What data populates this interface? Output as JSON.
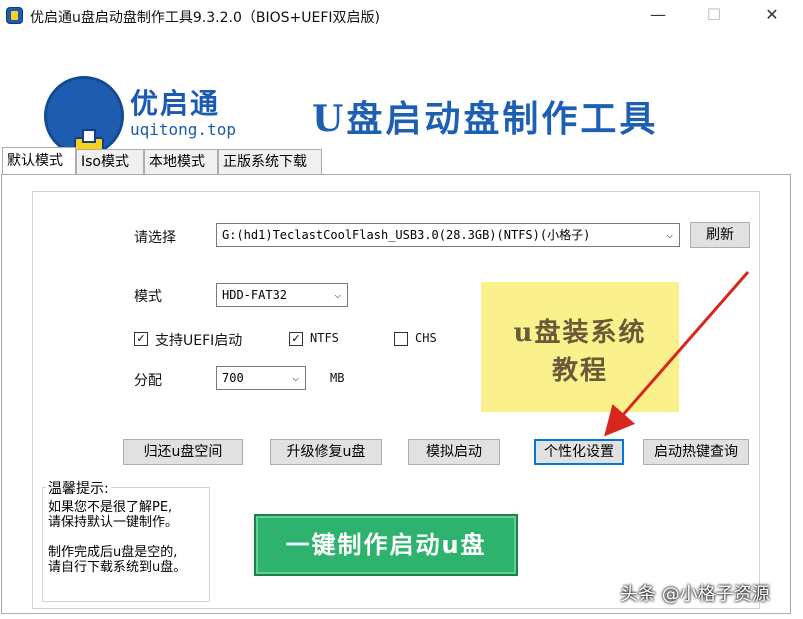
{
  "window": {
    "title": "优启通u盘启动盘制作工具9.3.2.0（BIOS+UEFI双启版)",
    "minimize": "—",
    "maximize": "☐",
    "close": "✕"
  },
  "banner": {
    "logo_name": "优启通",
    "logo_domain": "uqitong.top",
    "heading": "U盘启动盘制作工具"
  },
  "tabs": [
    "默认模式",
    "Iso模式",
    "本地模式",
    "正版系统下载"
  ],
  "form": {
    "select_label": "请选择",
    "device_value": "G:(hd1)TeclastCoolFlash_USB3.0(28.3GB)(NTFS)(小格子)",
    "refresh_label": "刷新",
    "mode_label": "模式",
    "mode_value": "HDD-FAT32",
    "uefi_label": "支持UEFI启动",
    "uefi_checked": true,
    "ntfs_label": "NTFS",
    "ntfs_checked": true,
    "chs_label": "CHS",
    "chs_checked": false,
    "alloc_label": "分配",
    "alloc_value": "700",
    "alloc_unit": "MB"
  },
  "promo": {
    "line1": "u盘装系统",
    "line2": "教程"
  },
  "buttons": {
    "restore": "归还u盘空间",
    "upgrade": "升级修复u盘",
    "simulate": "模拟启动",
    "personalize": "个性化设置",
    "hotkey": "启动热键查询",
    "make": "一键制作启动u盘"
  },
  "tips": {
    "title": "温馨提示:",
    "lines": [
      "如果您不是很了解PE,",
      "请保持默认一键制作。",
      "",
      "制作完成后u盘是空的,",
      "请自行下载系统到u盘。"
    ]
  },
  "watermark": "头条 @小格子资源",
  "colors": {
    "accent_blue": "#1d5fb3",
    "make_green": "#2db36e",
    "promo_yellow": "#fbf18c",
    "arrow_red": "#d9261c"
  }
}
